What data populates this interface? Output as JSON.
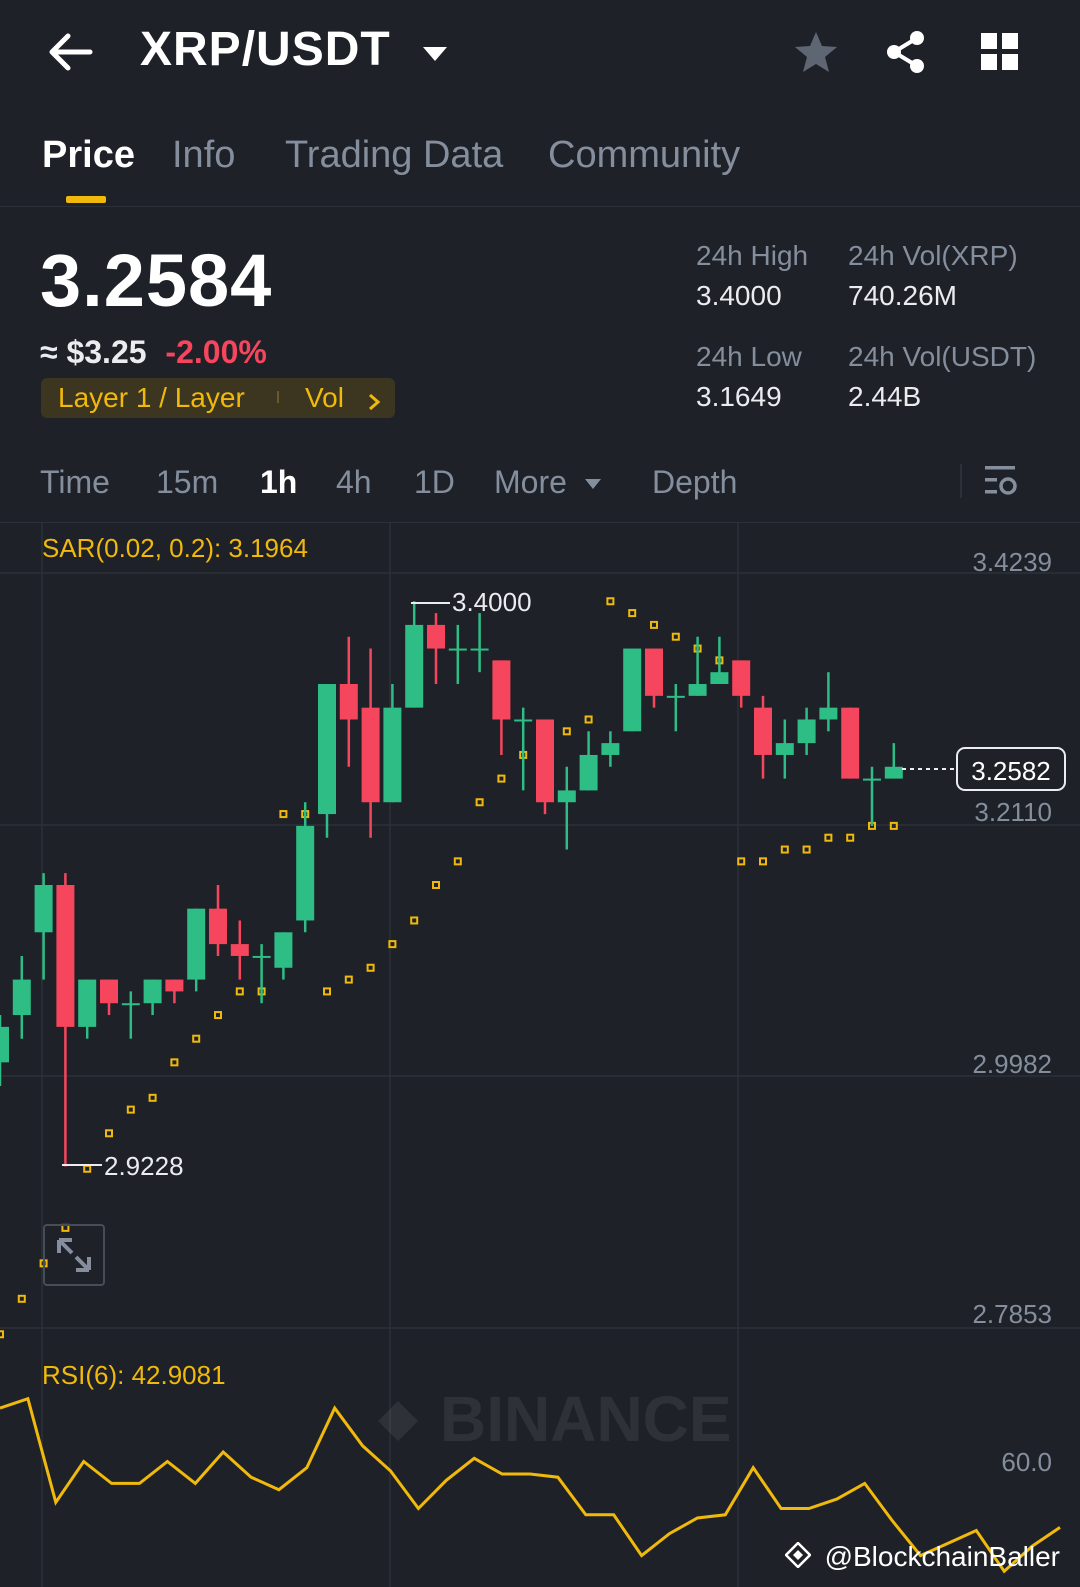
{
  "header": {
    "pair": "XRP/USDT",
    "back_icon": "arrow-left-icon",
    "favorite_icon": "star-icon",
    "share_icon": "share-icon",
    "grid_icon": "grid-icon"
  },
  "tabs": [
    {
      "label": "Price",
      "active": true
    },
    {
      "label": "Info"
    },
    {
      "label": "Trading Data"
    },
    {
      "label": "Community"
    }
  ],
  "price": {
    "last": "3.2584",
    "approx_prefix": "≈",
    "fiat": "$3.25",
    "change": "-2.00%",
    "tag_primary": "Layer 1 / Layer",
    "tag_secondary": "Vol"
  },
  "stats": {
    "high_label": "24h High",
    "high_value": "3.4000",
    "low_label": "24h Low",
    "low_value": "3.1649",
    "vol_base_label": "24h Vol(XRP)",
    "vol_base_value": "740.26M",
    "vol_quote_label": "24h Vol(USDT)",
    "vol_quote_value": "2.44B"
  },
  "intervals": [
    {
      "label": "Time"
    },
    {
      "label": "15m"
    },
    {
      "label": "1h",
      "active": true
    },
    {
      "label": "4h"
    },
    {
      "label": "1D"
    },
    {
      "label": "More"
    },
    {
      "label": "Depth"
    }
  ],
  "colors": {
    "up": "#2ebd85",
    "down": "#f6465d",
    "accent": "#f0b90b",
    "background": "#1e2128"
  },
  "chart_data": {
    "type": "candlestick",
    "interval": "1h",
    "sar_label": "SAR(0.02, 0.2): 3.1964",
    "rsi_label": "RSI(6): 42.9081",
    "y_ticks": [
      "3.4239",
      "3.2110",
      "2.9982",
      "2.7853"
    ],
    "rsi_tick": "60.0",
    "current_price": "3.2582",
    "high_marker": "3.4000",
    "low_marker": "2.9228",
    "watermark": "BINANCE",
    "source_credit": "@BlockchainBaller",
    "ylim": [
      2.7853,
      3.4239
    ],
    "candles": [
      {
        "o": 3.01,
        "h": 3.05,
        "l": 2.99,
        "c": 3.04
      },
      {
        "o": 3.05,
        "h": 3.1,
        "l": 3.03,
        "c": 3.08
      },
      {
        "o": 3.12,
        "h": 3.17,
        "l": 3.08,
        "c": 3.16
      },
      {
        "o": 3.16,
        "h": 3.17,
        "l": 2.922,
        "c": 3.04
      },
      {
        "o": 3.04,
        "h": 3.08,
        "l": 3.03,
        "c": 3.08
      },
      {
        "o": 3.08,
        "h": 3.08,
        "l": 3.05,
        "c": 3.06
      },
      {
        "o": 3.06,
        "h": 3.07,
        "l": 3.03,
        "c": 3.06
      },
      {
        "o": 3.06,
        "h": 3.08,
        "l": 3.05,
        "c": 3.08
      },
      {
        "o": 3.08,
        "h": 3.08,
        "l": 3.06,
        "c": 3.07
      },
      {
        "o": 3.08,
        "h": 3.14,
        "l": 3.07,
        "c": 3.14
      },
      {
        "o": 3.14,
        "h": 3.16,
        "l": 3.1,
        "c": 3.11
      },
      {
        "o": 3.11,
        "h": 3.13,
        "l": 3.08,
        "c": 3.1
      },
      {
        "o": 3.1,
        "h": 3.11,
        "l": 3.06,
        "c": 3.1
      },
      {
        "o": 3.09,
        "h": 3.12,
        "l": 3.08,
        "c": 3.12
      },
      {
        "o": 3.13,
        "h": 3.23,
        "l": 3.12,
        "c": 3.21
      },
      {
        "o": 3.22,
        "h": 3.33,
        "l": 3.2,
        "c": 3.33
      },
      {
        "o": 3.33,
        "h": 3.37,
        "l": 3.26,
        "c": 3.3
      },
      {
        "o": 3.31,
        "h": 3.36,
        "l": 3.2,
        "c": 3.23
      },
      {
        "o": 3.23,
        "h": 3.33,
        "l": 3.23,
        "c": 3.31
      },
      {
        "o": 3.31,
        "h": 3.4,
        "l": 3.31,
        "c": 3.38
      },
      {
        "o": 3.38,
        "h": 3.39,
        "l": 3.33,
        "c": 3.36
      },
      {
        "o": 3.36,
        "h": 3.38,
        "l": 3.33,
        "c": 3.36
      },
      {
        "o": 3.36,
        "h": 3.39,
        "l": 3.34,
        "c": 3.36
      },
      {
        "o": 3.35,
        "h": 3.35,
        "l": 3.27,
        "c": 3.3
      },
      {
        "o": 3.3,
        "h": 3.31,
        "l": 3.24,
        "c": 3.3
      },
      {
        "o": 3.3,
        "h": 3.3,
        "l": 3.22,
        "c": 3.23
      },
      {
        "o": 3.23,
        "h": 3.26,
        "l": 3.19,
        "c": 3.24
      },
      {
        "o": 3.24,
        "h": 3.29,
        "l": 3.24,
        "c": 3.27
      },
      {
        "o": 3.27,
        "h": 3.29,
        "l": 3.26,
        "c": 3.28
      },
      {
        "o": 3.29,
        "h": 3.36,
        "l": 3.29,
        "c": 3.36
      },
      {
        "o": 3.36,
        "h": 3.36,
        "l": 3.31,
        "c": 3.32
      },
      {
        "o": 3.32,
        "h": 3.33,
        "l": 3.29,
        "c": 3.32
      },
      {
        "o": 3.32,
        "h": 3.37,
        "l": 3.32,
        "c": 3.33
      },
      {
        "o": 3.33,
        "h": 3.37,
        "l": 3.33,
        "c": 3.34
      },
      {
        "o": 3.35,
        "h": 3.35,
        "l": 3.31,
        "c": 3.32
      },
      {
        "o": 3.31,
        "h": 3.32,
        "l": 3.25,
        "c": 3.27
      },
      {
        "o": 3.27,
        "h": 3.3,
        "l": 3.25,
        "c": 3.28
      },
      {
        "o": 3.28,
        "h": 3.31,
        "l": 3.27,
        "c": 3.3
      },
      {
        "o": 3.3,
        "h": 3.34,
        "l": 3.29,
        "c": 3.31
      },
      {
        "o": 3.31,
        "h": 3.31,
        "l": 3.25,
        "c": 3.25
      },
      {
        "o": 3.25,
        "h": 3.26,
        "l": 3.21,
        "c": 3.25
      },
      {
        "o": 3.25,
        "h": 3.28,
        "l": 3.25,
        "c": 3.26
      }
    ],
    "sar": [
      2.78,
      2.81,
      2.84,
      2.87,
      2.92,
      2.95,
      2.97,
      2.98,
      3.01,
      3.03,
      3.05,
      3.07,
      3.07,
      3.22,
      3.22,
      3.07,
      3.08,
      3.09,
      3.11,
      3.13,
      3.16,
      3.18,
      3.23,
      3.25,
      3.27,
      3.28,
      3.29,
      3.3,
      3.4,
      3.39,
      3.38,
      3.37,
      3.36,
      3.35,
      3.18,
      3.18,
      3.19,
      3.19,
      3.2,
      3.2,
      3.21,
      3.21
    ],
    "rsi": [
      72,
      75,
      42,
      55,
      48,
      48,
      55,
      48,
      58,
      50,
      46,
      53,
      72,
      60,
      52,
      40,
      49,
      56,
      51,
      51,
      50,
      38,
      38,
      25,
      32,
      37,
      38,
      53,
      40,
      40,
      43,
      48,
      36,
      25,
      29,
      33,
      20,
      28,
      34
    ]
  }
}
